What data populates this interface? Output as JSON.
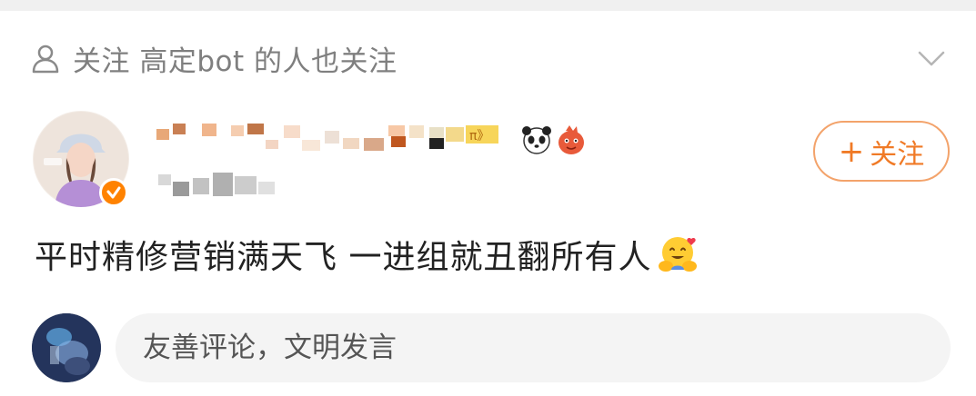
{
  "recommend_header": {
    "text": "关注 高定bot 的人也关注",
    "person_icon": "person-icon",
    "collapse_icon": "chevron-down-icon"
  },
  "profile": {
    "name": "",
    "subtitle": "",
    "verified": true,
    "badge_color": "#ff8200",
    "name_emojis": [
      "panda-icon",
      "cartoon-character-icon"
    ]
  },
  "follow_button": {
    "label": "关注",
    "plus": "+",
    "accent": "#f07a26"
  },
  "post": {
    "text": "平时精修营销满天飞 一进组就丑翻所有人",
    "emoji": "hugging-face-icon"
  },
  "comment": {
    "placeholder": "友善评论，文明发言",
    "value": ""
  }
}
